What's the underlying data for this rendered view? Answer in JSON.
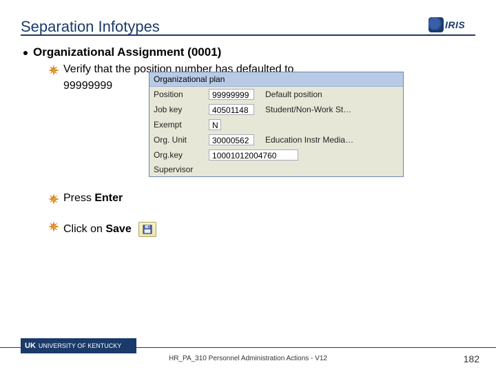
{
  "logo_text": "IRIS",
  "title": "Separation Infotypes",
  "level1": "Organizational Assignment (0001)",
  "bullet_a_prefix": "Verify that the position number has defaulted to",
  "bullet_a_value": "99999999",
  "bullet_b_pre": "Press ",
  "bullet_b_key": "Enter",
  "bullet_c_pre": "Click on ",
  "bullet_c_key": "Save",
  "panel": {
    "header": "Organizational plan",
    "rows": {
      "position_label": "Position",
      "position_value": "99999999",
      "position_desc": "Default position",
      "jobkey_label": "Job key",
      "jobkey_value": "40501148",
      "jobkey_desc": "Student/Non-Work St…",
      "exempt_label": "Exempt",
      "exempt_value": "N",
      "orgunit_label": "Org. Unit",
      "orgunit_value": "30000562",
      "orgunit_desc": "Education Instr Media…",
      "orgkey_label": "Org.key",
      "orgkey_value": "10001012004760",
      "supervisor_label": "Supervisor"
    }
  },
  "footer": {
    "uk_mark": "UK",
    "uk_text": "UNIVERSITY OF KENTUCKY",
    "center": "HR_PA_310 Personnel Administration Actions - V12",
    "page": "182"
  }
}
